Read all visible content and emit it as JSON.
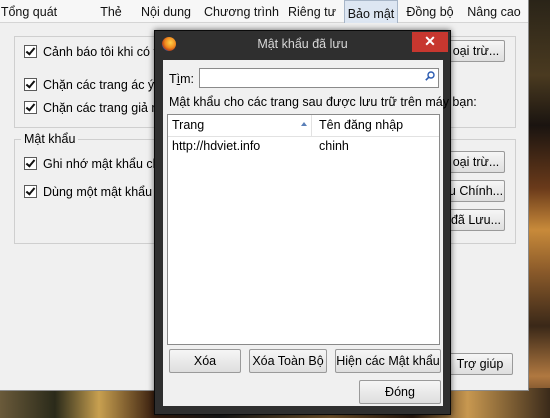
{
  "options": {
    "tabs": [
      "Tổng quát",
      "Thẻ",
      "Nội dung",
      "Chương trình",
      "Riêng tư",
      "Bảo mật",
      "Đồng bộ",
      "Nâng cao"
    ],
    "active_tab": "Bảo mật",
    "checkboxes": [
      "Cảnh báo tôi khi có tra",
      "Chặn các trang ác ý",
      "Chặn các trang giả mạ",
      "Ghi nhớ mật khẩu cho",
      "Dùng một mật khẩu c"
    ],
    "password_group_title": "Mật khẩu",
    "buttons": {
      "exceptions_1": "oại trừ...",
      "exceptions_2": "oại trừ...",
      "master_password": "u Chính...",
      "saved_passwords": "đã Lưu...",
      "help": "Trợ giúp"
    }
  },
  "dialog": {
    "title": "Mật khẩu đã lưu",
    "close_glyph": "✕",
    "search_label_prefix": "T",
    "search_label_underlined": "ì",
    "search_label_suffix": "m:",
    "search_value": "",
    "description": "Mật khẩu cho các trang sau được lưu trữ trên máy bạn:",
    "columns": [
      "Trang",
      "Tên đăng nhập"
    ],
    "rows": [
      {
        "site": "http://hdviet.info",
        "username": "chinh"
      }
    ],
    "buttons": {
      "remove": "Xóa",
      "remove_all": "Xóa Toàn Bộ",
      "show_passwords": "Hiện các Mật khẩu",
      "close": "Đóng"
    }
  }
}
